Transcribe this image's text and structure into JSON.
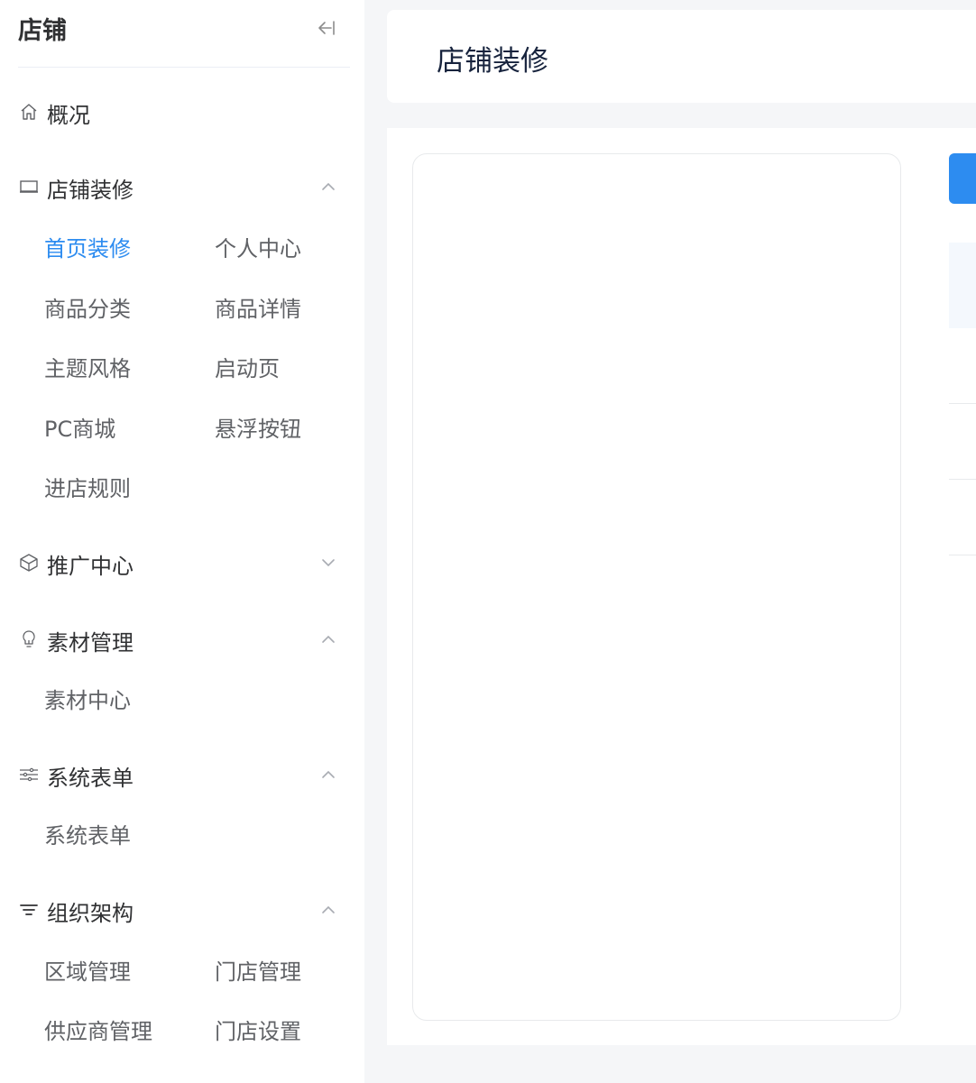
{
  "sidebar": {
    "title": "店铺",
    "collapse_icon": "collapse-left-icon",
    "menu": {
      "overview": {
        "label": "概况",
        "icon": "home-icon"
      },
      "decoration": {
        "label": "店铺装修",
        "icon": "monitor-icon",
        "expanded": true,
        "items": [
          "首页装修",
          "个人中心",
          "商品分类",
          "商品详情",
          "主题风格",
          "启动页",
          "PC商城",
          "悬浮按钮",
          "进店规则"
        ],
        "active_item": "首页装修"
      },
      "promotion": {
        "label": "推广中心",
        "icon": "box-icon",
        "expanded": false
      },
      "materials": {
        "label": "素材管理",
        "icon": "bulb-icon",
        "expanded": true,
        "items": [
          "素材中心"
        ]
      },
      "forms": {
        "label": "系统表单",
        "icon": "sliders-icon",
        "expanded": true,
        "items": [
          "系统表单"
        ]
      },
      "org": {
        "label": "组织架构",
        "icon": "filter-icon",
        "expanded": true,
        "items": [
          "区域管理",
          "门店管理",
          "供应商管理",
          "门店设置"
        ]
      }
    }
  },
  "main": {
    "page_title": "店铺装修"
  },
  "colors": {
    "accent": "#2d8cf0",
    "page_background": "#f5f6f8",
    "title_text": "#17233d"
  }
}
